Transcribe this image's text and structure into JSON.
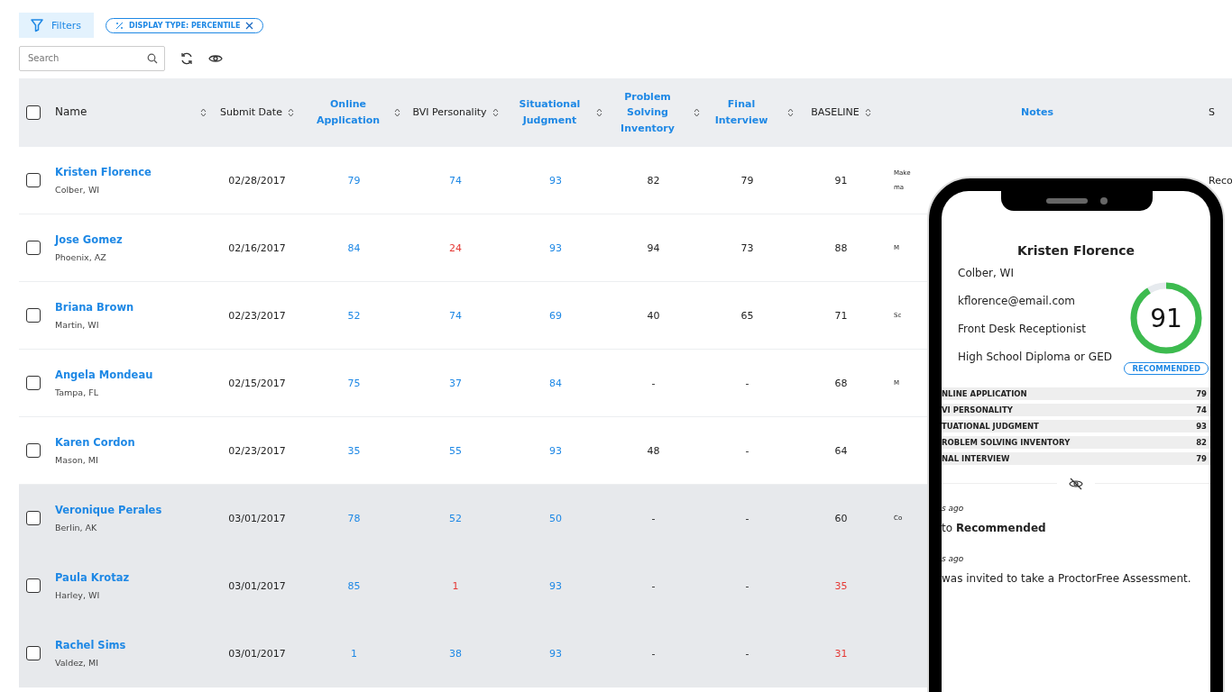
{
  "toolbar": {
    "filters_label": "Filters",
    "chip": {
      "label": "DISPLAY TYPE: PERCENTILE"
    },
    "search": {
      "placeholder": "Search"
    }
  },
  "table": {
    "columns": [
      {
        "label": "Name",
        "sortable": true,
        "link": false
      },
      {
        "label": "Submit Date",
        "sortable": true,
        "link": false
      },
      {
        "label": "Online Application",
        "sortable": true,
        "link": true,
        "values_link": true
      },
      {
        "label": "BVI Personality",
        "sortable": true,
        "link": false,
        "values_link": true
      },
      {
        "label": "Situational Judgment",
        "sortable": true,
        "link": true,
        "values_link": true
      },
      {
        "label": "Problem Solving Inventory",
        "sortable": true,
        "link": true,
        "values_link": false
      },
      {
        "label": "Final Interview",
        "sortable": true,
        "link": true,
        "values_link": false
      },
      {
        "label": "BASELINE",
        "sortable": true,
        "link": false,
        "values_link": false
      },
      {
        "label": "Notes",
        "sortable": false,
        "link": true
      },
      {
        "label": "S",
        "sortable": false,
        "link": false
      }
    ],
    "header_checked": false,
    "rows": [
      {
        "name": "Kristen Florence",
        "location": "Colber, WI",
        "date": "02/28/2017",
        "checked": false,
        "highlighted": false,
        "note": "Make",
        "note_2": "ma",
        "status": "Reco",
        "scores": [
          {
            "value": "79",
            "low": false
          },
          {
            "value": "74",
            "low": false
          },
          {
            "value": "93",
            "low": false
          },
          {
            "value": "82",
            "low": false
          },
          {
            "value": "79",
            "low": false
          },
          {
            "value": "91",
            "low": false
          }
        ]
      },
      {
        "name": "Jose Gomez",
        "location": "Phoenix, AZ",
        "date": "02/16/2017",
        "checked": false,
        "highlighted": false,
        "note": "M",
        "scores": [
          {
            "value": "84",
            "low": false
          },
          {
            "value": "24",
            "low": true
          },
          {
            "value": "93",
            "low": false
          },
          {
            "value": "94",
            "low": false
          },
          {
            "value": "73",
            "low": false
          },
          {
            "value": "88",
            "low": false
          }
        ]
      },
      {
        "name": "Briana Brown",
        "location": "Martin, WI",
        "date": "02/23/2017",
        "checked": false,
        "highlighted": false,
        "note": "Sc",
        "scores": [
          {
            "value": "52",
            "low": false
          },
          {
            "value": "74",
            "low": false
          },
          {
            "value": "69",
            "low": false
          },
          {
            "value": "40",
            "low": false
          },
          {
            "value": "65",
            "low": false
          },
          {
            "value": "71",
            "low": false
          }
        ]
      },
      {
        "name": "Angela Mondeau",
        "location": "Tampa, FL",
        "date": "02/15/2017",
        "checked": false,
        "highlighted": false,
        "note": "M",
        "scores": [
          {
            "value": "75",
            "low": false
          },
          {
            "value": "37",
            "low": false
          },
          {
            "value": "84",
            "low": false
          },
          {
            "value": "-",
            "low": false
          },
          {
            "value": "-",
            "low": false
          },
          {
            "value": "68",
            "low": false
          }
        ]
      },
      {
        "name": "Karen Cordon",
        "location": "Mason, MI",
        "date": "02/23/2017",
        "checked": false,
        "highlighted": false,
        "scores": [
          {
            "value": "35",
            "low": false
          },
          {
            "value": "55",
            "low": false
          },
          {
            "value": "93",
            "low": false
          },
          {
            "value": "48",
            "low": false
          },
          {
            "value": "-",
            "low": false
          },
          {
            "value": "64",
            "low": false
          }
        ]
      },
      {
        "name": "Veronique Perales",
        "location": "Berlin, AK",
        "date": "03/01/2017",
        "checked": false,
        "highlighted": true,
        "note": "Co",
        "scores": [
          {
            "value": "78",
            "low": false
          },
          {
            "value": "52",
            "low": false
          },
          {
            "value": "50",
            "low": false
          },
          {
            "value": "-",
            "low": false
          },
          {
            "value": "-",
            "low": false
          },
          {
            "value": "60",
            "low": false
          }
        ]
      },
      {
        "name": "Paula Krotaz",
        "location": "Harley, WI",
        "date": "03/01/2017",
        "checked": false,
        "highlighted": true,
        "scores": [
          {
            "value": "85",
            "low": false
          },
          {
            "value": "1",
            "low": true
          },
          {
            "value": "93",
            "low": false
          },
          {
            "value": "-",
            "low": false
          },
          {
            "value": "-",
            "low": false
          },
          {
            "value": "35",
            "low": true
          }
        ]
      },
      {
        "name": "Rachel Sims",
        "location": "Valdez, MI",
        "date": "03/01/2017",
        "checked": false,
        "highlighted": true,
        "scores": [
          {
            "value": "1",
            "low": false
          },
          {
            "value": "38",
            "low": false
          },
          {
            "value": "93",
            "low": false
          },
          {
            "value": "-",
            "low": false
          },
          {
            "value": "-",
            "low": false
          },
          {
            "value": "31",
            "low": true
          }
        ]
      }
    ]
  },
  "phone": {
    "name": "Kristen Florence",
    "details": [
      "Colber, WI",
      "kflorence@email.com",
      "Front Desk Receptionist",
      "High School Diploma or GED"
    ],
    "score": {
      "value": "91",
      "level": 0.91
    },
    "badge": "RECOMMENDED",
    "score_rows": [
      {
        "label": "NLINE APPLICATION",
        "value": "79"
      },
      {
        "label": "VI PERSONALITY",
        "value": "74"
      },
      {
        "label": "TUATIONAL JUDGMENT",
        "value": "93"
      },
      {
        "label": "ROBLEM SOLVING INVENTORY",
        "value": "82"
      },
      {
        "label": "NAL INTERVIEW",
        "value": "79"
      }
    ],
    "activity": [
      {
        "time": "s ago",
        "text": "to **Recommended**"
      },
      {
        "time": "s ago",
        "text": "was invited to take a ProctorFree Assessment."
      }
    ]
  }
}
